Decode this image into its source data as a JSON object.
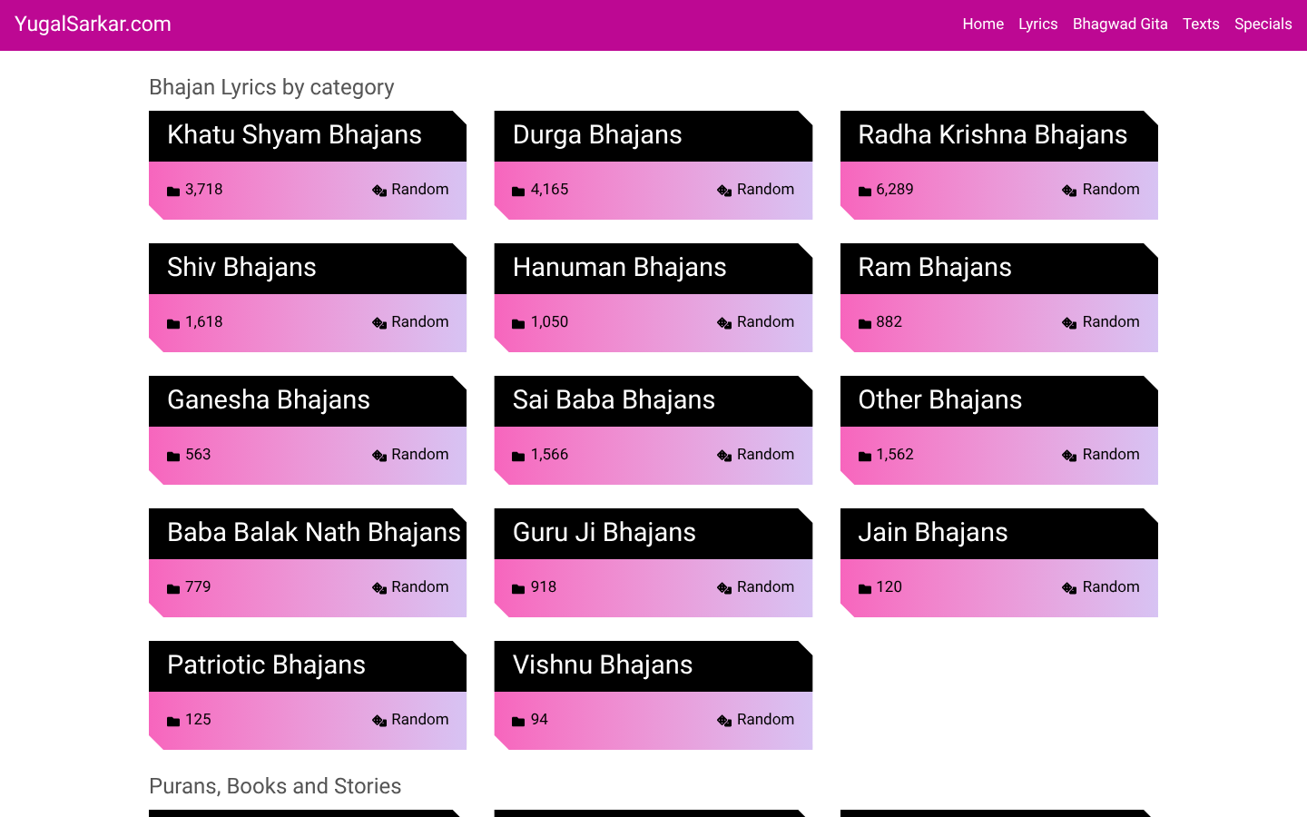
{
  "navbar": {
    "brand": "YugalSarkar.com",
    "links": [
      "Home",
      "Lyrics",
      "Bhagwad Gita",
      "Texts",
      "Specials"
    ]
  },
  "sections": [
    {
      "heading": "Bhajan Lyrics by category",
      "cards": [
        {
          "kind": "category",
          "title": "Khatu Shyam Bhajans",
          "count": "3,718",
          "action": "Random"
        },
        {
          "kind": "category",
          "title": "Durga Bhajans",
          "count": "4,165",
          "action": "Random"
        },
        {
          "kind": "category",
          "title": "Radha Krishna Bhajans",
          "count": "6,289",
          "action": "Random"
        },
        {
          "kind": "category",
          "title": "Shiv Bhajans",
          "count": "1,618",
          "action": "Random"
        },
        {
          "kind": "category",
          "title": "Hanuman Bhajans",
          "count": "1,050",
          "action": "Random"
        },
        {
          "kind": "category",
          "title": "Ram Bhajans",
          "count": "882",
          "action": "Random"
        },
        {
          "kind": "category",
          "title": "Ganesha Bhajans",
          "count": "563",
          "action": "Random"
        },
        {
          "kind": "category",
          "title": "Sai Baba Bhajans",
          "count": "1,566",
          "action": "Random"
        },
        {
          "kind": "category",
          "title": "Other Bhajans",
          "count": "1,562",
          "action": "Random"
        },
        {
          "kind": "category",
          "title": "Baba Balak Nath Bhajans",
          "count": "779",
          "action": "Random"
        },
        {
          "kind": "category",
          "title": "Guru Ji Bhajans",
          "count": "918",
          "action": "Random"
        },
        {
          "kind": "category",
          "title": "Jain Bhajans",
          "count": "120",
          "action": "Random"
        },
        {
          "kind": "category",
          "title": "Patriotic Bhajans",
          "count": "125",
          "action": "Random"
        },
        {
          "kind": "category",
          "title": "Vishnu Bhajans",
          "count": "94",
          "action": "Random"
        }
      ]
    },
    {
      "heading": "Purans, Books and Stories",
      "cards": [
        {
          "kind": "cut"
        },
        {
          "kind": "cut"
        },
        {
          "kind": "cut"
        }
      ]
    }
  ]
}
